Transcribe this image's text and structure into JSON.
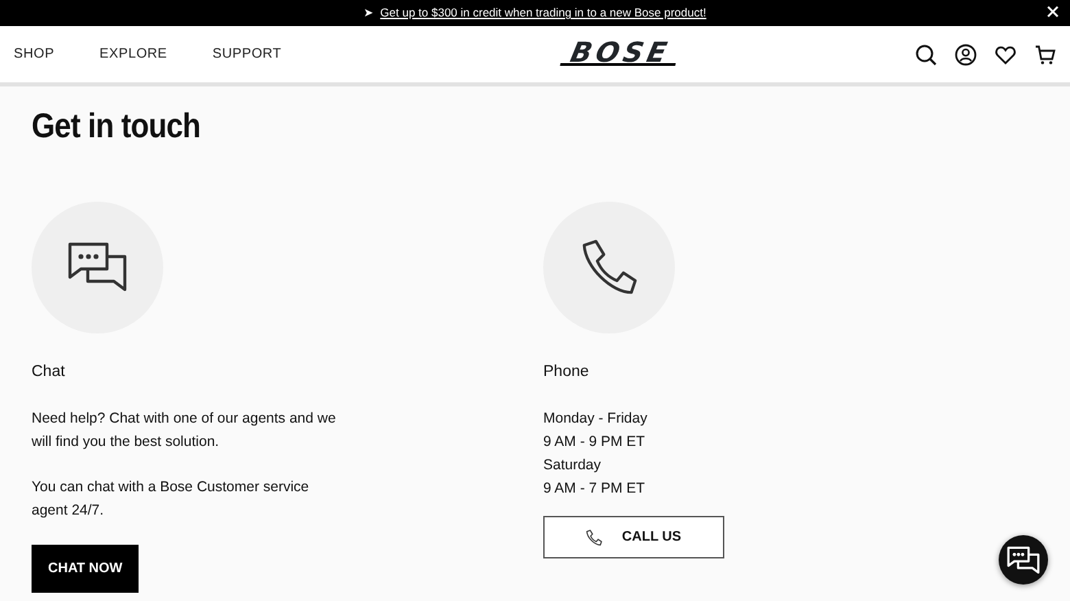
{
  "promo_banner": {
    "arrow": "➤",
    "link": "Get up to $300 in credit when trading in to a new Bose product!"
  },
  "header": {
    "nav": [
      "SHOP",
      "EXPLORE",
      "SUPPORT"
    ],
    "logo": "BOSE"
  },
  "heading": "Get in touch",
  "contact_options": [
    {
      "kind": "chat",
      "title": "Chat",
      "paragraphs": [
        "Need help? Chat with one of our agents and we will find you the best solution.",
        "You can chat with a Bose Customer service agent 24/7."
      ],
      "button": "CHAT NOW"
    },
    {
      "kind": "phone",
      "title": "Phone",
      "lines": [
        "Monday - Friday",
        "9 AM - 9 PM ET",
        "Saturday",
        "9 AM - 7 PM ET"
      ],
      "button": "CALL US"
    }
  ]
}
